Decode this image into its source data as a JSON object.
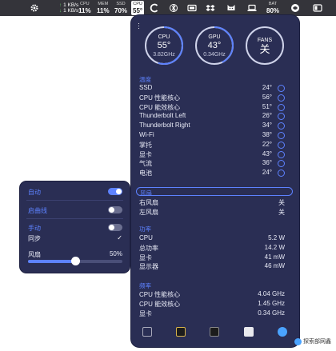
{
  "menubar": {
    "net": {
      "up": "1 KB/s",
      "down": "1 KB/s"
    },
    "cpu": {
      "label": "CPU",
      "value": "11%"
    },
    "mem": {
      "label": "MEM",
      "value": "11%"
    },
    "ssd": {
      "label": "SSD",
      "value": "70%"
    },
    "cpu_temp": {
      "label": "CPU",
      "value": "55°"
    },
    "bat": {
      "label": "BAT",
      "value": "80%"
    }
  },
  "gauges": [
    {
      "label": "CPU",
      "value": "55°",
      "sub": "3.82GHz",
      "fraction": 0.55
    },
    {
      "label": "GPU",
      "value": "43°",
      "sub": "0.34GHz",
      "fraction": 0.43
    },
    {
      "label": "FANS",
      "value": "关",
      "sub": ""
    }
  ],
  "temperature": {
    "title": "温度",
    "rows": [
      {
        "label": "SSD",
        "value": "24°"
      },
      {
        "label": "CPU 性能核心",
        "value": "56°"
      },
      {
        "label": "CPU 能效核心",
        "value": "51°"
      },
      {
        "label": "Thunderbolt Left",
        "value": "26°"
      },
      {
        "label": "Thunderbolt Right",
        "value": "34°"
      },
      {
        "label": "Wi-Fi",
        "value": "38°"
      },
      {
        "label": "掌托",
        "value": "22°"
      },
      {
        "label": "显卡",
        "value": "43°"
      },
      {
        "label": "气流",
        "value": "36°"
      },
      {
        "label": "电池",
        "value": "24°"
      }
    ]
  },
  "fans": {
    "title": "风扇",
    "rows": [
      {
        "label": "右风扇",
        "value": "关"
      },
      {
        "label": "左风扇",
        "value": "关"
      }
    ]
  },
  "power": {
    "title": "功率",
    "rows": [
      {
        "label": "CPU",
        "value": "5.2 W"
      },
      {
        "label": "总功率",
        "value": "14.2 W"
      },
      {
        "label": "显卡",
        "value": "41 mW"
      },
      {
        "label": "显示器",
        "value": "46 mW"
      }
    ]
  },
  "frequency": {
    "title": "频率",
    "rows": [
      {
        "label": "CPU 性能核心",
        "value": "4.04 GHz"
      },
      {
        "label": "CPU 能效核心",
        "value": "1.45 GHz"
      },
      {
        "label": "显卡",
        "value": "0.34 GHz"
      }
    ]
  },
  "popover": {
    "auto_label": "自动",
    "auto_on": true,
    "curve_label": "启曲线",
    "curve_on": false,
    "manual_label": "手动",
    "manual_on": false,
    "sync_label": "同步",
    "sync_check": "✓",
    "fan_label": "风扇",
    "fan_value": "50%",
    "fan_fraction": 0.5
  },
  "watermark": {
    "text": "探索部网鑫"
  },
  "colors": {
    "panel": "#2a2e54",
    "accent": "#5d82ff",
    "menubar": "#34343a"
  }
}
